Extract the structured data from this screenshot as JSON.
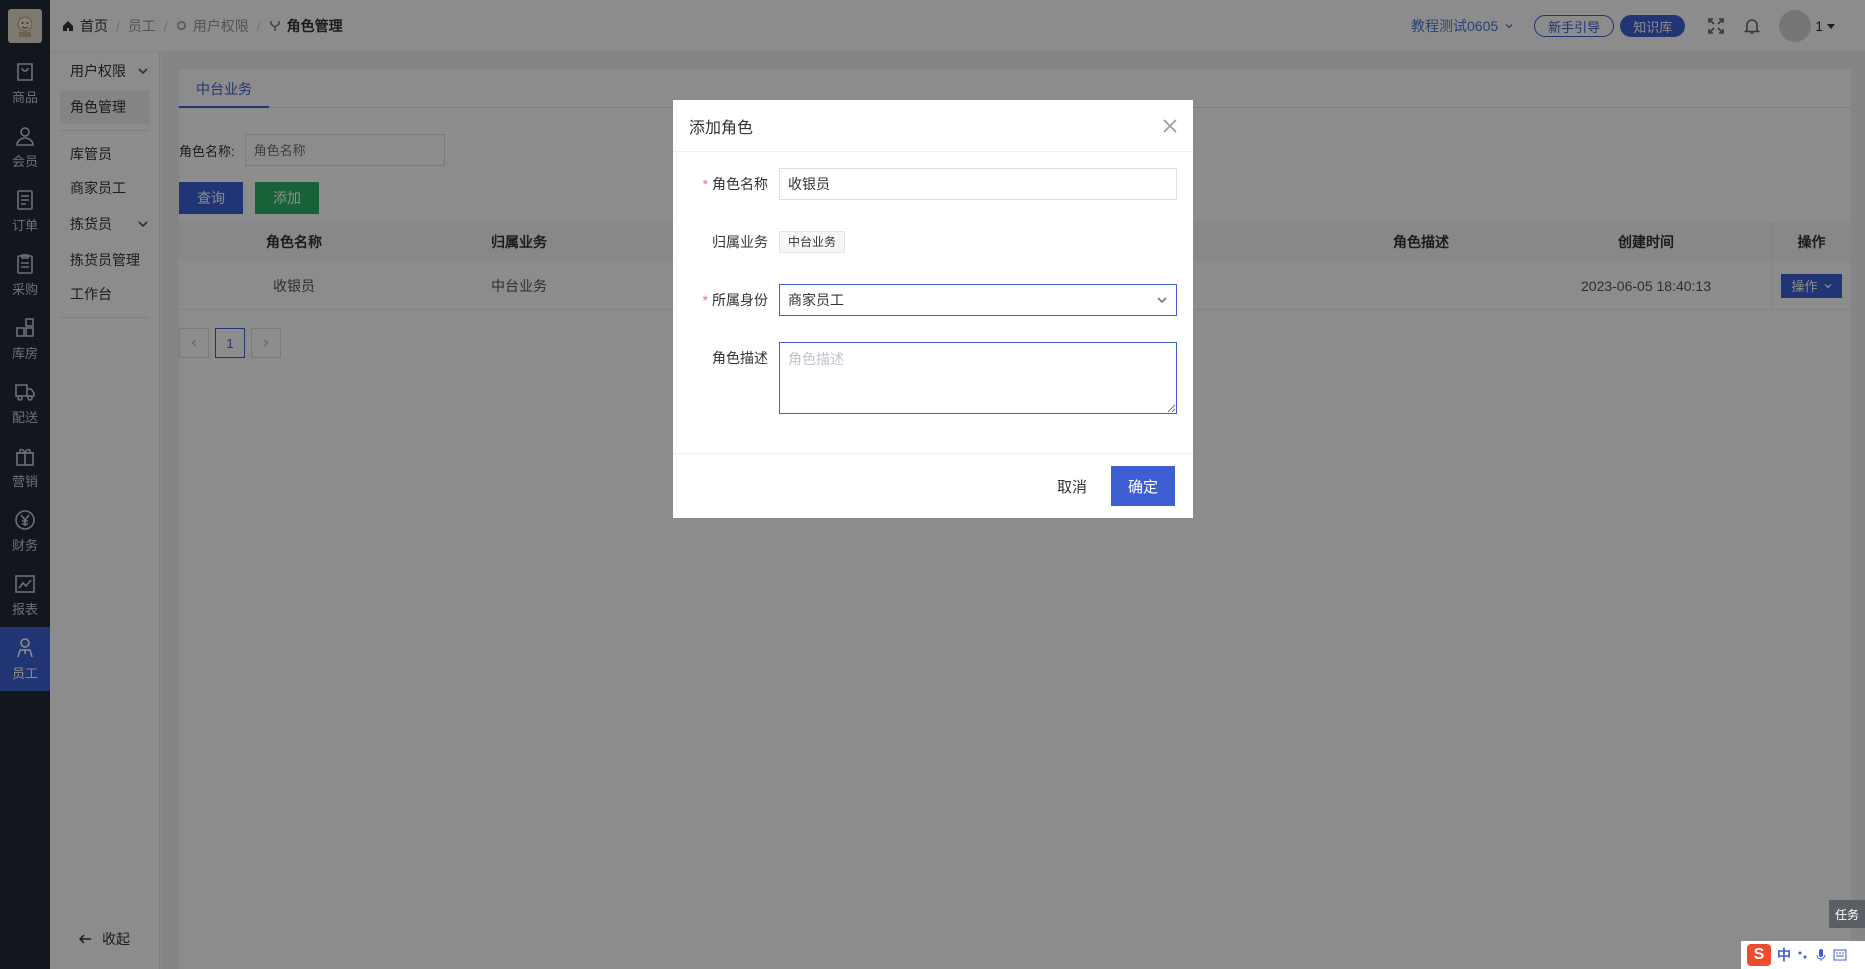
{
  "rail": {
    "items": [
      {
        "label": "商品",
        "icon": "bag-icon"
      },
      {
        "label": "会员",
        "icon": "user-icon"
      },
      {
        "label": "订单",
        "icon": "order-icon"
      },
      {
        "label": "采购",
        "icon": "clipboard-icon"
      },
      {
        "label": "库房",
        "icon": "warehouse-icon"
      },
      {
        "label": "配送",
        "icon": "truck-icon"
      },
      {
        "label": "营销",
        "icon": "gift-icon"
      },
      {
        "label": "财务",
        "icon": "yen-icon"
      },
      {
        "label": "报表",
        "icon": "chart-icon"
      },
      {
        "label": "员工",
        "icon": "staff-icon"
      }
    ],
    "active": "员工"
  },
  "submenu": {
    "group1": "用户权限",
    "group1_items": [
      "角色管理"
    ],
    "item_kuguan": "库管员",
    "item_shangjia": "商家员工",
    "group2": "拣货员",
    "group2_items": [
      "拣货员管理",
      "工作台"
    ],
    "collapse": "收起"
  },
  "breadcrumb": {
    "home": "首页",
    "level1": "员工",
    "level2": "用户权限",
    "current": "角色管理"
  },
  "topbar": {
    "shop": "教程测试0605",
    "guide": "新手引导",
    "kb": "知识库",
    "user": "1"
  },
  "page": {
    "tab": "中台业务",
    "filter_label": "角色名称:",
    "filter_placeholder": "角色名称",
    "query_button": "查询",
    "add_button": "添加"
  },
  "table": {
    "headers": {
      "name": "角色名称",
      "biz": "归属业务",
      "desc": "角色描述",
      "created": "创建时间",
      "op": "操作"
    },
    "rows": [
      {
        "name": "收银员",
        "biz": "中台业务",
        "desc": "",
        "created": "2023-06-05 18:40:13",
        "op": "操作"
      }
    ]
  },
  "pager": {
    "current": "1"
  },
  "dialog": {
    "title": "添加角色",
    "name_label": "角色名称",
    "name_value": "收银员",
    "biz_label": "归属业务",
    "biz_tag": "中台业务",
    "identity_label": "所属身份",
    "identity_value": "商家员工",
    "desc_label": "角色描述",
    "desc_placeholder": "角色描述",
    "cancel": "取消",
    "ok": "确定"
  },
  "floating": {
    "task": "任务",
    "ime_zh": "中"
  },
  "colors": {
    "primary": "#3d5fd2",
    "success": "#2fb168",
    "rail_bg": "#222a35"
  }
}
